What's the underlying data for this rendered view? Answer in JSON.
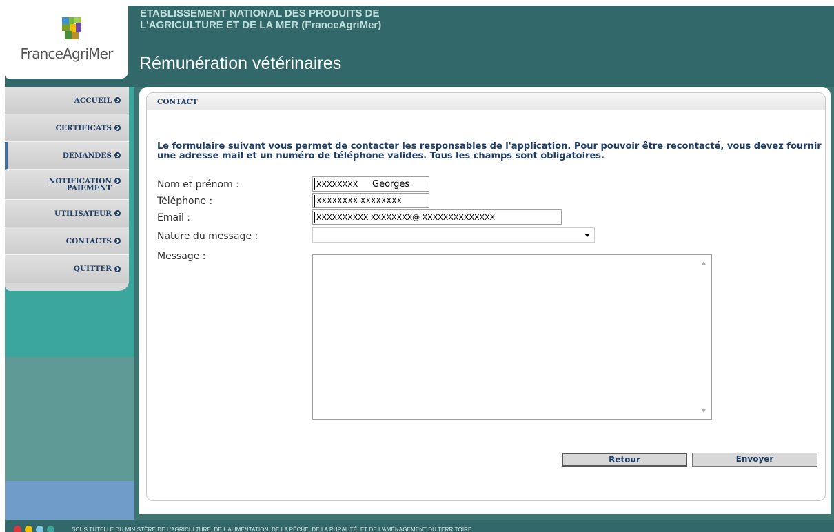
{
  "header": {
    "logo_text": "FranceAgriMer",
    "org_line1": "ETABLISSEMENT NATIONAL DES PRODUITS DE",
    "org_line2": "L'AGRICULTURE ET DE LA MER (FranceAgriMer)",
    "app_title": "Rémunération vétérinaires"
  },
  "sidebar": {
    "items": [
      {
        "label": "ACCUEIL"
      },
      {
        "label": "CERTIFICATS"
      },
      {
        "label": "DEMANDES",
        "active": true
      },
      {
        "label_line1": "NOTIFICATION",
        "label_line2": "PAIEMENT"
      },
      {
        "label": "UTILISATEUR"
      },
      {
        "label": "CONTACTS"
      },
      {
        "label": "QUITTER"
      }
    ]
  },
  "contact": {
    "title": "CONTACT",
    "intro": "Le formulaire suivant vous permet de contacter les responsables de l'application. Pour pouvoir être recontacté, vous devez fournir une adresse mail et un numéro de téléphone valides. Tous les champs sont obligatoires.",
    "fields": {
      "name_label": "Nom et prénom :",
      "name_mask": "XXXXXXXX",
      "name_value": "Georges",
      "phone_label": "Téléphone :",
      "phone_mask": "XXXXXXXX XXXXXXXX",
      "email_label": "Email :",
      "email_mask": "XXXXXXXXXX XXXXXXXX@ XXXXXXXXXXXXXX",
      "nature_label": "Nature du message :",
      "nature_value": "",
      "message_label": "Message :",
      "message_value": ""
    },
    "buttons": {
      "back": "Retour",
      "send": "Envoyer"
    }
  },
  "footer": {
    "text": "SOUS TUTELLE DU MINISTÈRE DE L'AGRICULTURE, DE L'ALIMENTATION, DE LA PÊCHE, DE LA RURALITÉ, ET DE L'AMÉNAGEMENT DU TERRITOIRE",
    "dot_colors": [
      "#e0343a",
      "#f2c000",
      "#7fc8e8",
      "#3aa69c"
    ]
  },
  "colors": {
    "header": "#33686a",
    "sidebar_teal": "#3aa69c",
    "menu_text": "#1f3d66",
    "accent_blue": "#3d6fa8"
  }
}
